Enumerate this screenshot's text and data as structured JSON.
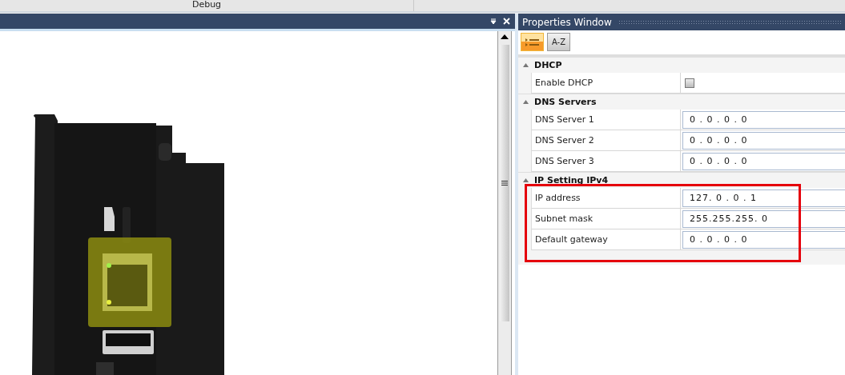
{
  "top_bar": {
    "tab": "Debug"
  },
  "properties_window": {
    "title": "Properties Window",
    "toolbar": [
      {
        "kind": "categorized",
        "selected": true
      },
      {
        "kind": "alphabetical",
        "label": "A-Z",
        "selected": false
      }
    ],
    "categories": [
      {
        "name": "DHCP",
        "expanded": true,
        "rows": [
          {
            "label": "Enable DHCP",
            "kind": "checkbox",
            "checked": false
          }
        ]
      },
      {
        "name": "DNS Servers",
        "expanded": true,
        "rows": [
          {
            "label": "DNS Server 1",
            "kind": "ip",
            "value": "0 . 0 . 0 . 0"
          },
          {
            "label": "DNS Server 2",
            "kind": "ip",
            "value": "0 . 0 . 0 . 0"
          },
          {
            "label": "DNS Server 3",
            "kind": "ip",
            "value": "0 . 0 . 0 . 0"
          }
        ]
      },
      {
        "name": "IP Setting IPv4",
        "expanded": true,
        "highlighted": true,
        "rows": [
          {
            "label": "IP address",
            "kind": "ip",
            "value": "127. 0 . 0 . 1"
          },
          {
            "label": "Subnet mask",
            "kind": "ip",
            "value": "255.255.255. 0"
          },
          {
            "label": "Default gateway",
            "kind": "ip",
            "value": "0 . 0 . 0 . 0"
          }
        ]
      }
    ]
  }
}
